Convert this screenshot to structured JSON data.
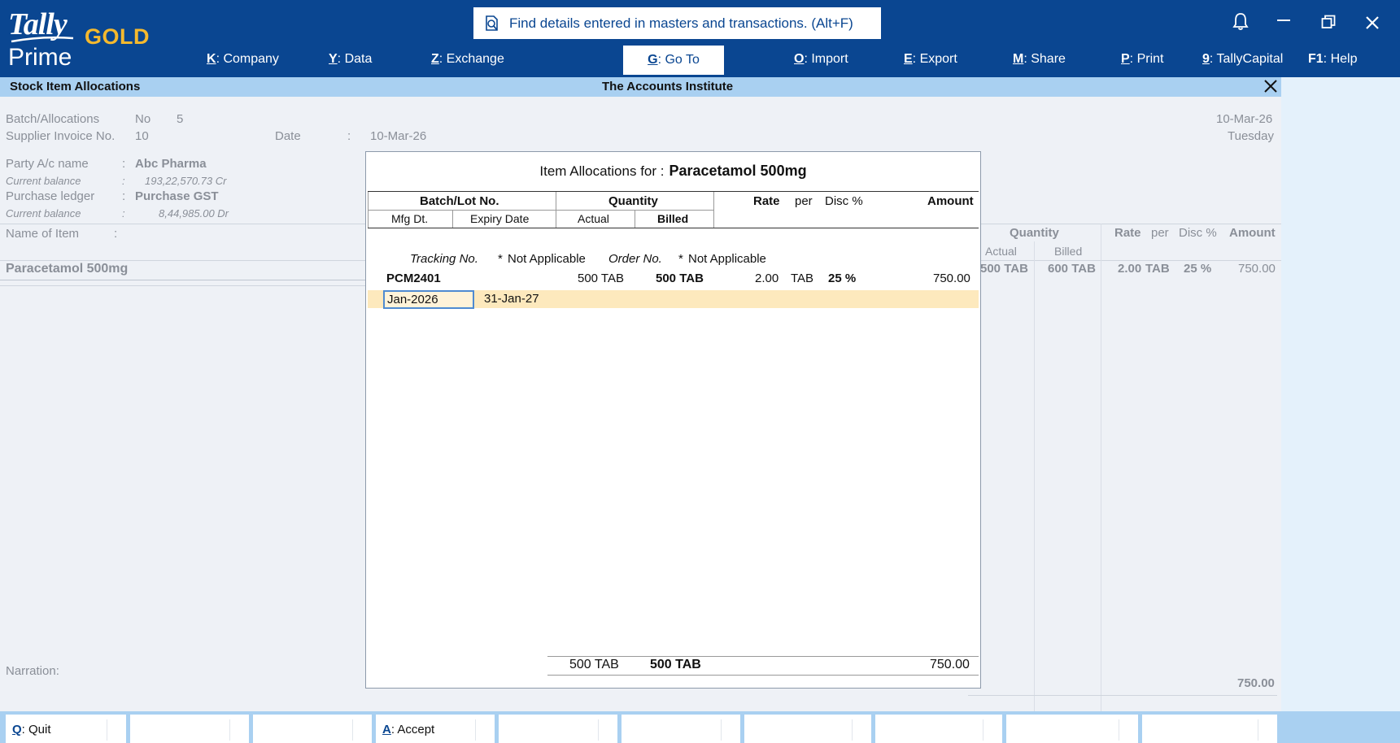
{
  "header": {
    "logo_tally": "Tally",
    "logo_gold": "GOLD",
    "logo_prime": "Prime",
    "search_placeholder": "Find details entered in masters and transactions. (Alt+F)",
    "menu": [
      {
        "key": "K",
        "label": ": Company"
      },
      {
        "key": "Y",
        "label": ": Data"
      },
      {
        "key": "Z",
        "label": ": Exchange"
      },
      {
        "key": "G",
        "label": ": Go To"
      },
      {
        "key": "O",
        "label": ": Import"
      },
      {
        "key": "E",
        "label": ": Export"
      },
      {
        "key": "M",
        "label": ": Share"
      },
      {
        "key": "P",
        "label": ": Print"
      },
      {
        "key": "9",
        "label": ": TallyCapital"
      },
      {
        "key": "F1",
        "label": ": Help"
      }
    ]
  },
  "titlebar": {
    "screen_name": "Stock Item Allocations",
    "company": "The Accounts Institute"
  },
  "voucher": {
    "batch_label": "Batch/Allocations",
    "batch_value": "No",
    "batch_number": "5",
    "supplier_invoice_label": "Supplier Invoice No.",
    "supplier_invoice_value": "10",
    "date_label": "Date",
    "date_sep": ":",
    "date_value": "10-Mar-26",
    "voucher_date": "10-Mar-26",
    "voucher_day": "Tuesday",
    "party_label": "Party A/c name",
    "party_value": "Abc Pharma",
    "party_balance_label": "Current balance",
    "party_balance": "193,22,570.73 Cr",
    "ledger_label": "Purchase ledger",
    "ledger_value": "Purchase GST",
    "ledger_balance_label": "Current balance",
    "ledger_balance": "8,44,985.00 Dr",
    "colon": ":",
    "name_of_item_label": "Name of Item",
    "col_quantity": "Quantity",
    "col_actual": "Actual",
    "col_billed": "Billed",
    "col_rate": "Rate",
    "col_per": "per",
    "col_disc": "Disc %",
    "col_amount": "Amount",
    "item_name": "Paracetamol 500mg",
    "item_actual": "500 TAB",
    "item_billed": "600 TAB",
    "item_rate": "2.00",
    "item_per": "TAB",
    "item_disc": "25 %",
    "item_amount": "750.00",
    "narration_label": "Narration:",
    "total_amount": "750.00"
  },
  "modal": {
    "title_prefix": "Item Allocations for :",
    "title_item": "Paracetamol 500mg",
    "hdr_batch": "Batch/Lot No.",
    "hdr_quantity": "Quantity",
    "hdr_rate": "Rate",
    "hdr_per": "per",
    "hdr_disc": "Disc %",
    "hdr_amount": "Amount",
    "hdr_mfg": "Mfg Dt.",
    "hdr_expiry": "Expiry Date",
    "hdr_actual": "Actual",
    "hdr_billed": "Billed",
    "tracking_label": "Tracking No.",
    "tracking_value": "Not Applicable",
    "order_label": "Order No.",
    "order_value": "Not Applicable",
    "star": "*",
    "row": {
      "batch": "PCM2401",
      "actual": "500 TAB",
      "billed": "500 TAB",
      "rate": "2.00",
      "per": "TAB",
      "disc": "25 %",
      "amount": "750.00",
      "mfg_value": "Jan-2026",
      "expiry": "31-Jan-27"
    },
    "total_actual": "500 TAB",
    "total_billed": "500 TAB",
    "total_amount": "750.00"
  },
  "footer": {
    "quit_key": "Q",
    "quit_label": ": Quit",
    "accept_key": "A",
    "accept_label": ": Accept"
  },
  "colors": {
    "header_bg": "#0a4691",
    "title_bg": "#a9d0f1",
    "gold": "#f5b92e",
    "selection": "#fde9bd"
  }
}
